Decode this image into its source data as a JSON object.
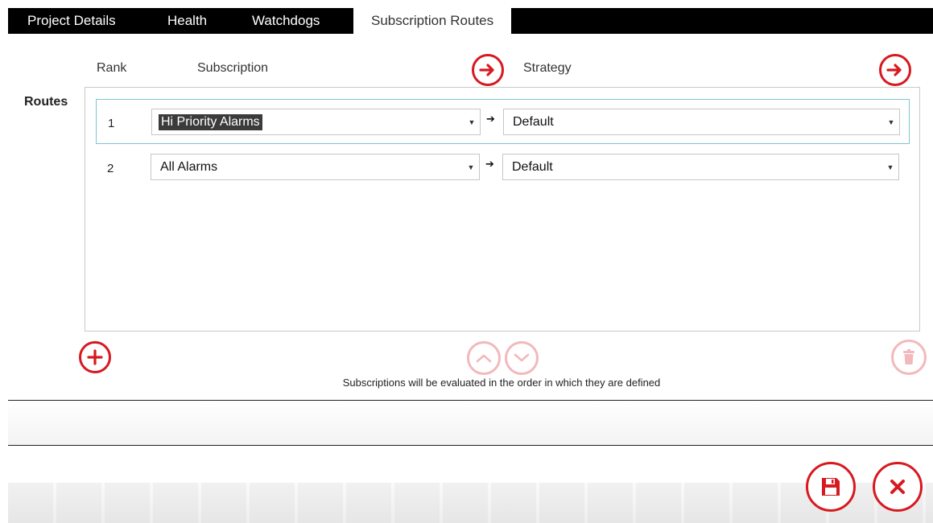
{
  "tabs": [
    {
      "label": "Project Details",
      "active": false
    },
    {
      "label": "Health",
      "active": false
    },
    {
      "label": "Watchdogs",
      "active": false
    },
    {
      "label": "Subscription Routes",
      "active": true
    }
  ],
  "columns": {
    "rank": "Rank",
    "subscription": "Subscription",
    "strategy": "Strategy"
  },
  "routes_label": "Routes",
  "routes": [
    {
      "rank": "1",
      "subscription": "Hi Priority Alarms",
      "strategy": "Default",
      "selected": true
    },
    {
      "rank": "2",
      "subscription": "All Alarms",
      "strategy": "Default",
      "selected": false
    }
  ],
  "note": "Subscriptions will be evaluated in the order in which they are defined",
  "icons": {
    "navigate_subscription": "arrow-right-circle-icon",
    "navigate_strategy": "arrow-right-circle-icon",
    "add": "plus-circle-icon",
    "move_up": "chevron-up-circle-icon",
    "move_down": "chevron-down-circle-icon",
    "delete": "trash-icon",
    "save": "floppy-disk-icon",
    "cancel": "close-icon"
  },
  "colors": {
    "accent": "#d71920",
    "accent_disabled": "#f2b9bc",
    "tabbar": "#000000",
    "selection_border": "#7ec3d6"
  }
}
